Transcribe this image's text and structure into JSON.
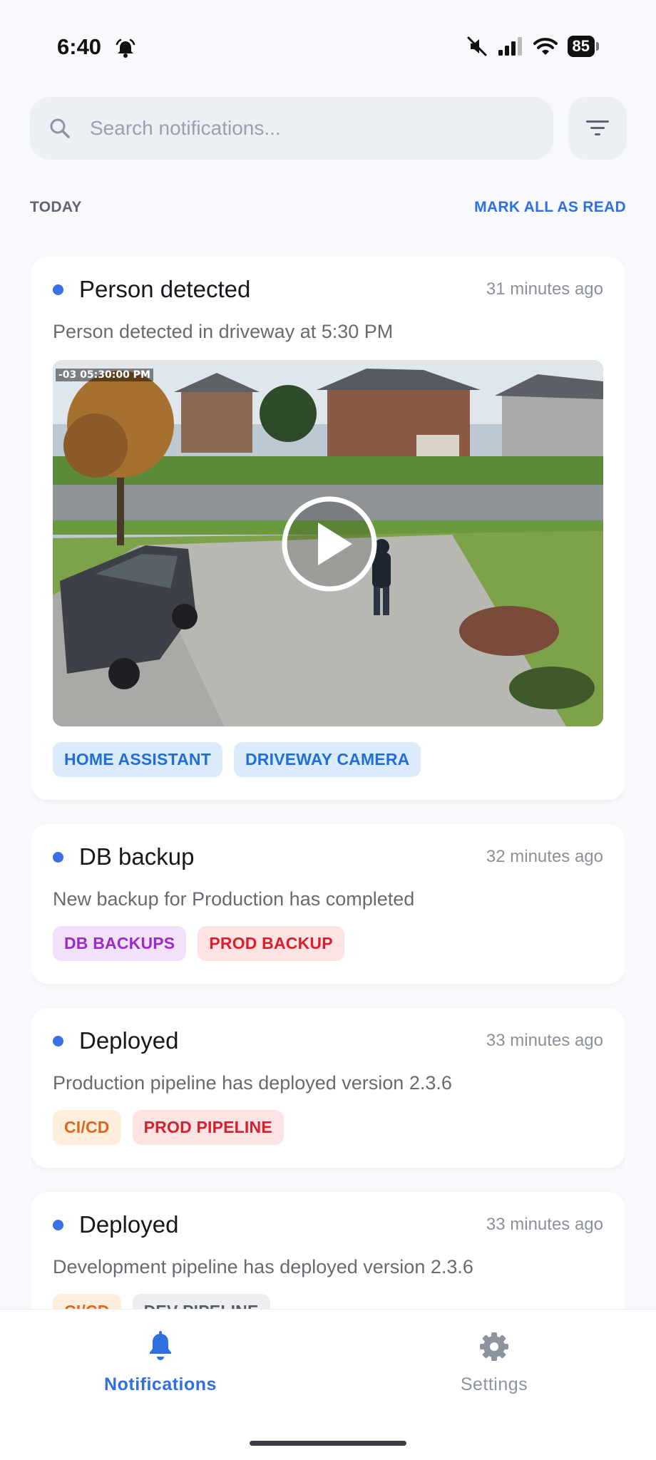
{
  "status_bar": {
    "time": "6:40",
    "battery": "85"
  },
  "search": {
    "placeholder": "Search notifications..."
  },
  "section": {
    "label": "TODAY",
    "mark_all": "MARK ALL AS READ"
  },
  "notifications": [
    {
      "title": "Person detected",
      "time": "31 minutes ago",
      "body": "Person detected in driveway at 5:30 PM",
      "video_timestamp": "-03 05:30:00 PM",
      "tags": [
        {
          "label": "HOME ASSISTANT",
          "color": "#1f6fd6",
          "bg": "#dcebfb"
        },
        {
          "label": "DRIVEWAY CAMERA",
          "color": "#1f6fd6",
          "bg": "#dcebfb"
        }
      ]
    },
    {
      "title": "DB backup",
      "time": "32 minutes ago",
      "body": "New backup for Production has completed",
      "tags": [
        {
          "label": "DB BACKUPS",
          "color": "#9b2cc4",
          "bg": "#f2e1fb"
        },
        {
          "label": "PROD BACKUP",
          "color": "#d6202a",
          "bg": "#fde3e4"
        }
      ]
    },
    {
      "title": "Deployed",
      "time": "33 minutes ago",
      "body": "Production pipeline has deployed version 2.3.6",
      "tags": [
        {
          "label": "CI/CD",
          "color": "#e0661b",
          "bg": "#fdeedd"
        },
        {
          "label": "PROD PIPELINE",
          "color": "#d6202a",
          "bg": "#fde3e4"
        }
      ]
    },
    {
      "title": "Deployed",
      "time": "33 minutes ago",
      "body": "Development pipeline has deployed version 2.3.6",
      "tags": [
        {
          "label": "CI/CD",
          "color": "#e0661b",
          "bg": "#fdeedd"
        },
        {
          "label": "DEV PIPELINE",
          "color": "#555b64",
          "bg": "#eceef1"
        }
      ]
    }
  ],
  "nav": {
    "notifications": "Notifications",
    "settings": "Settings",
    "active_color": "#2f6fe0",
    "inactive_color": "#8d949e"
  }
}
